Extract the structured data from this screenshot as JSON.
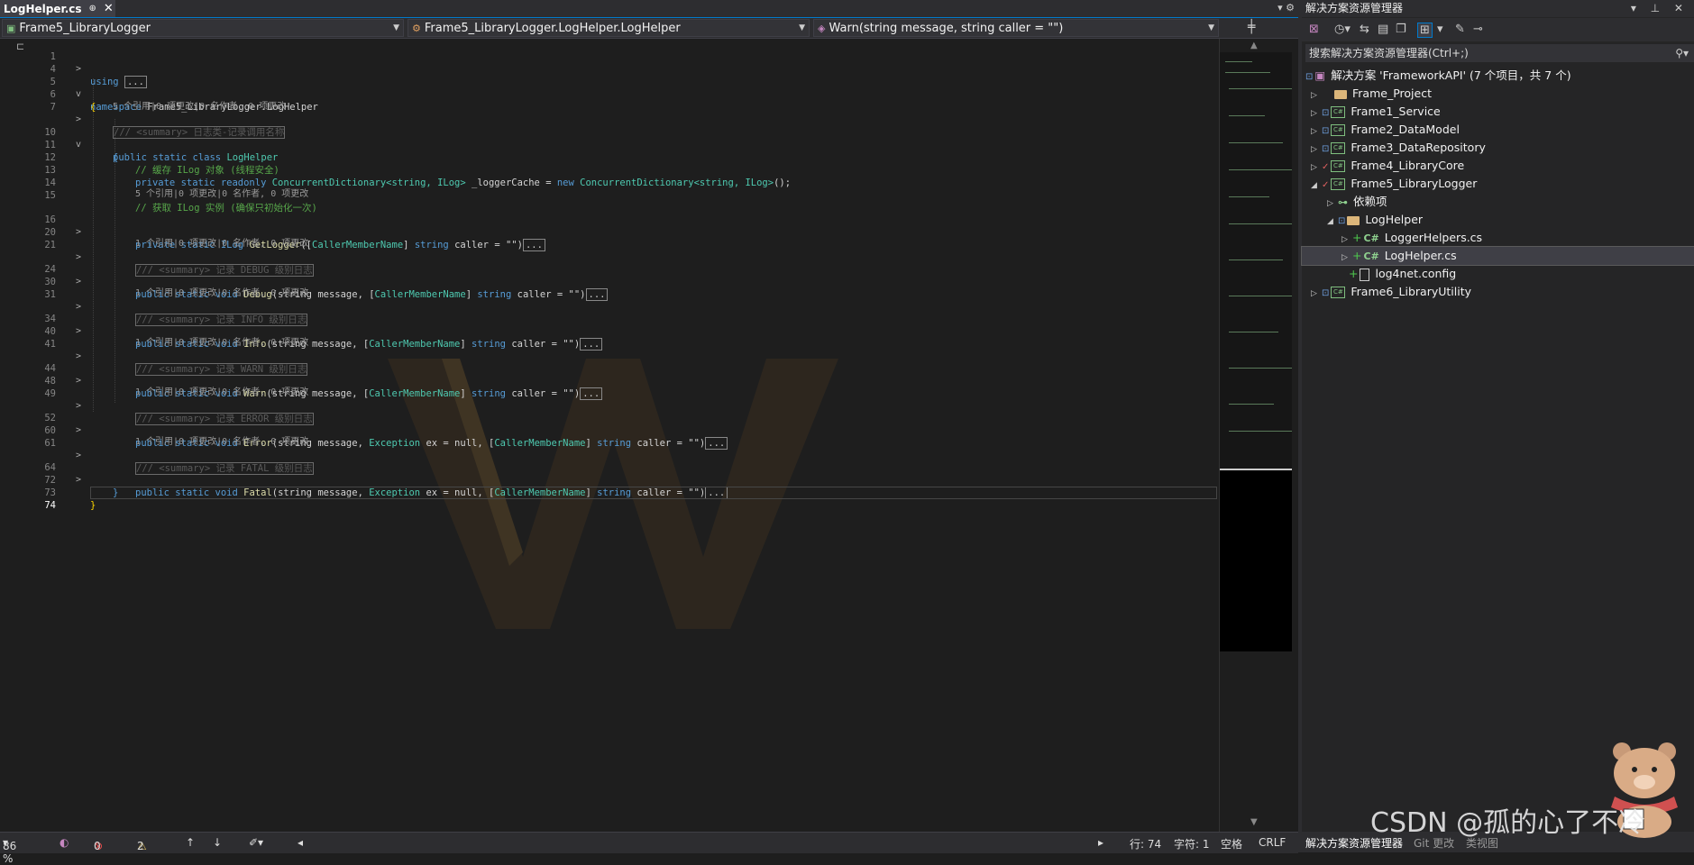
{
  "tab": {
    "label": "LogHelper.cs",
    "pin": "⊕",
    "close": "✕"
  },
  "navbar": {
    "project": "Frame5_LibraryLogger",
    "class": "Frame5_LibraryLogger.LogHelper.LogHelper",
    "member": "Warn(string message, string caller = \"\")"
  },
  "code": {
    "lines": [
      {
        "n": "1"
      },
      {
        "n": "4"
      },
      {
        "n": "5"
      },
      {
        "n": "6"
      },
      {
        "n": "7"
      },
      {
        "n": "10"
      },
      {
        "n": "11"
      },
      {
        "n": "12"
      },
      {
        "n": "13"
      },
      {
        "n": "14"
      },
      {
        "n": "15"
      },
      {
        "n": "16"
      },
      {
        "n": "20"
      },
      {
        "n": "21"
      },
      {
        "n": "24"
      },
      {
        "n": "30"
      },
      {
        "n": "31"
      },
      {
        "n": "34"
      },
      {
        "n": "40"
      },
      {
        "n": "41"
      },
      {
        "n": "44"
      },
      {
        "n": "48"
      },
      {
        "n": "49"
      },
      {
        "n": "52"
      },
      {
        "n": "60"
      },
      {
        "n": "61"
      },
      {
        "n": "64"
      },
      {
        "n": "72"
      },
      {
        "n": "73"
      },
      {
        "n": "74"
      }
    ],
    "using": "using",
    "ellipsis": "...",
    "namespace_kw": "namespace",
    "namespace_name": "Frame5_LibraryLogger.LogHelper",
    "brace_open": "{",
    "brace_close": "}",
    "summary_class": "/// <summary> 日志类-记录调用名称",
    "refs_class": "5 个引用|0 项更改|0 名作者, 0 项更改",
    "class_decl": "public static class",
    "class_name": "LogHelper",
    "comment_cache": "// 缓存 ILog 对象 (线程安全)",
    "cache_decl_a": "private static readonly",
    "cache_type": "ConcurrentDictionary",
    "cache_generic": "<string, ILog>",
    "cache_field": " _loggerCache = ",
    "cache_new": "new",
    "cache_ctor": "ConcurrentDictionary",
    "cache_ctor_generic": "<string, ILog>",
    "cache_end": "();",
    "comment_get": "// 获取 ILog 实例 (确保只初始化一次)",
    "refs_get": "5 个引用|0 项更改|0 名作者, 0 项更改",
    "get_decl": "private static ILog",
    "get_name": "GetLogger",
    "attr": "CallerMemberName",
    "str_kw": "string",
    "caller": "caller",
    "eq_empty": " = \"\")",
    "summary_debug": "/// <summary> 记录 DEBUG 级别日志",
    "summary_info": "/// <summary> 记录 INFO 级别日志",
    "summary_warn": "/// <summary> 记录 WARN 级别日志",
    "summary_error": "/// <summary> 记录 ERROR 级别日志",
    "summary_fatal": "/// <summary> 记录 FATAL 级别日志",
    "refs_one": "1 个引用|0 项更改|0 名作者, 0 项更改",
    "psv": "public static void",
    "m_debug": "Debug",
    "m_info": "Info",
    "m_warn": "Warn",
    "m_error": "Error",
    "m_fatal": "Fatal",
    "string_message": "string message, ",
    "exception": "Exception",
    "ex_null": " ex = null, "
  },
  "status": {
    "zoom": "86 %",
    "errors": "0",
    "warnings": "2",
    "line": "行: 74",
    "char": "字符: 1",
    "spaces": "空格",
    "eol": "CRLF"
  },
  "explorer": {
    "title": "解决方案资源管理器",
    "search_placeholder": "搜索解决方案资源管理器(Ctrl+;)",
    "solution": "解决方案 'FrameworkAPI' (7 个项目，共 7 个)",
    "items": [
      {
        "label": "Frame_Project"
      },
      {
        "label": "Frame1_Service"
      },
      {
        "label": "Frame2_DataModel"
      },
      {
        "label": "Frame3_DataRepository"
      },
      {
        "label": "Frame4_LibraryCore"
      },
      {
        "label": "Frame5_LibraryLogger"
      },
      {
        "label": "依赖项"
      },
      {
        "label": "LogHelper"
      },
      {
        "label": "LoggerHelpers.cs"
      },
      {
        "label": "LogHelper.cs"
      },
      {
        "label": "log4net.config"
      },
      {
        "label": "Frame6_LibraryUtility"
      }
    ],
    "bottom_tabs": [
      "解决方案资源管理器",
      "Git 更改",
      "类视图"
    ]
  },
  "watermark": "CSDN @孤的心了不冷",
  "colors": {
    "accent": "#007acc",
    "keyword": "#569cd6",
    "type": "#4ec9b0",
    "comment": "#57a64a",
    "string": "#d69d85"
  }
}
